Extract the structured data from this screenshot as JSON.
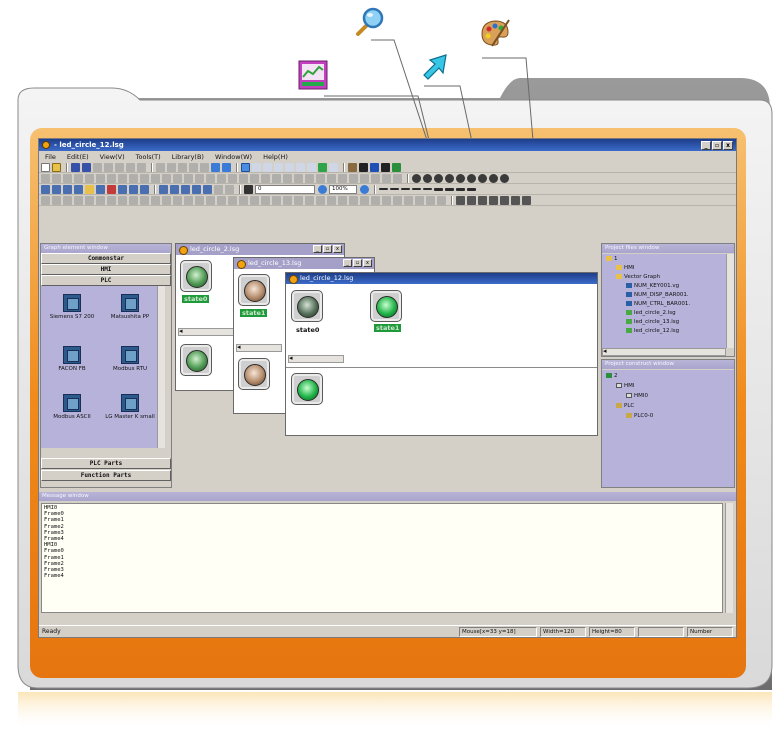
{
  "app": {
    "title": "- led_circle_12.lsg",
    "controls": [
      "_",
      "▫",
      "x"
    ],
    "menu": [
      "File",
      "Edit(E)",
      "View(V)",
      "Tools(T)",
      "Library(B)",
      "Window(W)",
      "Help(H)"
    ],
    "zoom_select": "100%",
    "line_select": "0"
  },
  "left_panel": {
    "title": "Graph element window",
    "top_buttons": [
      "Commonstar",
      "HMI",
      "PLC"
    ],
    "bottom_buttons": [
      "PLC Parts",
      "Function Parts"
    ],
    "library_items": [
      "Siemens S7 200",
      "Matsushita PP",
      "FACON FB",
      "Modbus RTU",
      "Modbus ASCII",
      "LG Master K small"
    ]
  },
  "documents": [
    {
      "title": "led_circle_2.lsg"
    },
    {
      "title": "led_circle_13.lsg"
    },
    {
      "title": "led_circle_12.lsg",
      "labels": [
        "state0",
        "state1"
      ]
    }
  ],
  "doc_labels": {
    "state0": "state0",
    "state1": "state1"
  },
  "right_top": {
    "title": "Project files window",
    "items": [
      "1",
      "HMI",
      "Vector Graph",
      "NUM_KEY001.vg",
      "NUM_DISP_BAR001.",
      "NUM_CTRL_BAR001.",
      "led_circle_2.lsg",
      "led_circle_13.lsg",
      "led_circle_12.lsg"
    ]
  },
  "right_bottom": {
    "title": "Project construct window",
    "items": [
      "2",
      "HMI",
      "HMI0",
      "PLC",
      "PLC0-0"
    ]
  },
  "message": {
    "title": "Message window",
    "lines": [
      "HMI0",
      "Frame0",
      "Frame1",
      "Frame2",
      "Frame3",
      "Frame4",
      "HMI0",
      "Frame0",
      "Frame1",
      "Frame2",
      "Frame3",
      "Frame4"
    ]
  },
  "status": {
    "ready": "Ready",
    "mouse": "Mouse[x=33  y=18]",
    "width": "Width=120",
    "height": "Height=80",
    "number": "Number"
  },
  "colors": {
    "title_bar": "#2a55b0",
    "panel_header": "#aba7d0",
    "panel_bg": "#b6b2da",
    "folder_orange": "#f09020",
    "state_badge": "#1e9a3a"
  },
  "icons": [
    "chart-icon",
    "magnifier-icon",
    "cursor-arrow-icon",
    "palette-icon"
  ]
}
